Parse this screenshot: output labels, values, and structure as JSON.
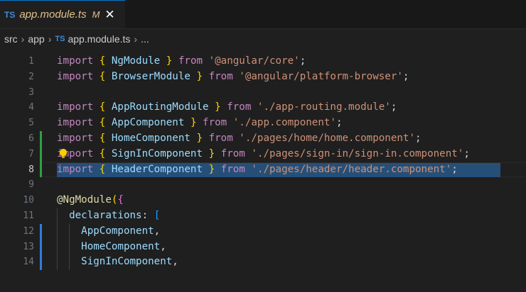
{
  "tab": {
    "lang_badge": "TS",
    "title": "app.module.ts",
    "status": "M",
    "close": "✕"
  },
  "breadcrumb": {
    "items": [
      "src",
      "app",
      "app.module.ts",
      "..."
    ],
    "sep": "›",
    "lang_badge": "TS"
  },
  "editor": {
    "active_line": 8,
    "lines": [
      {
        "n": "1",
        "tokens": [
          [
            "kw",
            "import"
          ],
          [
            "pl",
            " "
          ],
          [
            "br",
            "{"
          ],
          [
            "pl",
            " "
          ],
          [
            "id",
            "NgModule"
          ],
          [
            "pl",
            " "
          ],
          [
            "br",
            "}"
          ],
          [
            "pl",
            " "
          ],
          [
            "kw",
            "from"
          ],
          [
            "pl",
            " "
          ],
          [
            "str",
            "'@angular/core'"
          ],
          [
            "pl",
            ";"
          ]
        ]
      },
      {
        "n": "2",
        "tokens": [
          [
            "kw",
            "import"
          ],
          [
            "pl",
            " "
          ],
          [
            "br",
            "{"
          ],
          [
            "pl",
            " "
          ],
          [
            "id",
            "BrowserModule"
          ],
          [
            "pl",
            " "
          ],
          [
            "br",
            "}"
          ],
          [
            "pl",
            " "
          ],
          [
            "kw",
            "from"
          ],
          [
            "pl",
            " "
          ],
          [
            "str",
            "'@angular/platform-browser'"
          ],
          [
            "pl",
            ";"
          ]
        ]
      },
      {
        "n": "3",
        "tokens": []
      },
      {
        "n": "4",
        "tokens": [
          [
            "kw",
            "import"
          ],
          [
            "pl",
            " "
          ],
          [
            "br",
            "{"
          ],
          [
            "pl",
            " "
          ],
          [
            "id",
            "AppRoutingModule"
          ],
          [
            "pl",
            " "
          ],
          [
            "br",
            "}"
          ],
          [
            "pl",
            " "
          ],
          [
            "kw",
            "from"
          ],
          [
            "pl",
            " "
          ],
          [
            "str",
            "'./app-routing.module'"
          ],
          [
            "pl",
            ";"
          ]
        ]
      },
      {
        "n": "5",
        "tokens": [
          [
            "kw",
            "import"
          ],
          [
            "pl",
            " "
          ],
          [
            "br",
            "{"
          ],
          [
            "pl",
            " "
          ],
          [
            "id",
            "AppComponent"
          ],
          [
            "pl",
            " "
          ],
          [
            "br",
            "}"
          ],
          [
            "pl",
            " "
          ],
          [
            "kw",
            "from"
          ],
          [
            "pl",
            " "
          ],
          [
            "str",
            "'./app.component'"
          ],
          [
            "pl",
            ";"
          ]
        ]
      },
      {
        "n": "6",
        "tokens": [
          [
            "kw",
            "import"
          ],
          [
            "pl",
            " "
          ],
          [
            "br",
            "{"
          ],
          [
            "pl",
            " "
          ],
          [
            "id",
            "HomeComponent"
          ],
          [
            "pl",
            " "
          ],
          [
            "br",
            "}"
          ],
          [
            "pl",
            " "
          ],
          [
            "kw",
            "from"
          ],
          [
            "pl",
            " "
          ],
          [
            "str",
            "'./pages/home/home.component'"
          ],
          [
            "pl",
            ";"
          ]
        ]
      },
      {
        "n": "7",
        "tokens": [
          [
            "kw",
            "import"
          ],
          [
            "pl",
            " "
          ],
          [
            "br",
            "{"
          ],
          [
            "pl",
            " "
          ],
          [
            "id",
            "SignInComponent"
          ],
          [
            "pl",
            " "
          ],
          [
            "br",
            "}"
          ],
          [
            "pl",
            " "
          ],
          [
            "kw",
            "from"
          ],
          [
            "pl",
            " "
          ],
          [
            "str",
            "'./pages/sign-in/sign-in.component'"
          ],
          [
            "pl",
            ";"
          ]
        ]
      },
      {
        "n": "8",
        "tokens": [
          [
            "kw",
            "import"
          ],
          [
            "pl",
            " "
          ],
          [
            "br",
            "{"
          ],
          [
            "pl",
            " "
          ],
          [
            "id",
            "HeaderComponent"
          ],
          [
            "pl",
            " "
          ],
          [
            "br",
            "}"
          ],
          [
            "pl",
            " "
          ],
          [
            "kw",
            "from"
          ],
          [
            "pl",
            " "
          ],
          [
            "str",
            "'./pages/header/header.component'"
          ],
          [
            "pl",
            ";"
          ]
        ]
      },
      {
        "n": "9",
        "tokens": []
      },
      {
        "n": "10",
        "tokens": [
          [
            "fn",
            "@NgModule"
          ],
          [
            "br",
            "("
          ],
          [
            "br2",
            "{"
          ]
        ]
      },
      {
        "n": "11",
        "tokens": [
          [
            "pl",
            "  "
          ],
          [
            "id",
            "declarations"
          ],
          [
            "pl",
            ": "
          ],
          [
            "br3",
            "["
          ]
        ]
      },
      {
        "n": "12",
        "tokens": [
          [
            "pl",
            "    "
          ],
          [
            "id",
            "AppComponent"
          ],
          [
            "pl",
            ","
          ]
        ]
      },
      {
        "n": "13",
        "tokens": [
          [
            "pl",
            "    "
          ],
          [
            "id",
            "HomeComponent"
          ],
          [
            "pl",
            ","
          ]
        ]
      },
      {
        "n": "14",
        "tokens": [
          [
            "pl",
            "    "
          ],
          [
            "id",
            "SignInComponent"
          ],
          [
            "pl",
            ","
          ]
        ]
      }
    ]
  },
  "colors": {
    "accent": "#0078d4",
    "added": "#2ea043",
    "selection": "#264f78"
  }
}
